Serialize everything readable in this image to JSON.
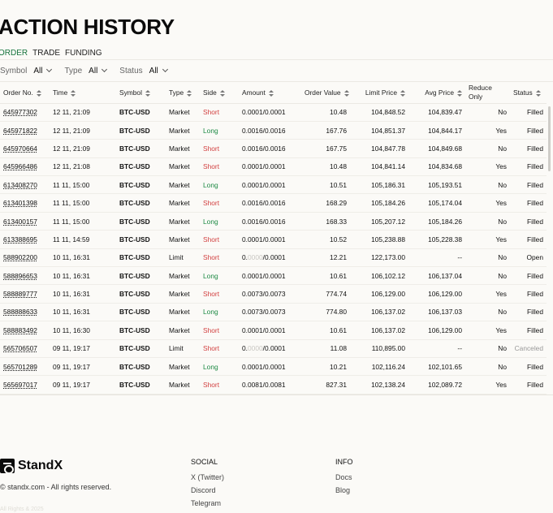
{
  "page": {
    "title": "ACTION HISTORY"
  },
  "tabs": [
    "ORDER",
    "TRADE",
    "FUNDING"
  ],
  "filters": [
    {
      "label": "Symbol",
      "value": "All"
    },
    {
      "label": "Type",
      "value": "All"
    },
    {
      "label": "Status",
      "value": "All"
    }
  ],
  "columns": [
    "Order No.",
    "Time",
    "Symbol",
    "Type",
    "Side",
    "Amount",
    "Order Value",
    "Limit Price",
    "Avg Price",
    "Reduce Only",
    "Status"
  ],
  "rows": [
    {
      "order_no": "645977302",
      "time": "12 11, 21:09",
      "symbol": "BTC-USD",
      "type": "Market",
      "side": "Short",
      "amount": "0.0001/0.0001",
      "order_value": "10.48",
      "limit_price": "104,848.52",
      "avg_price": "104,839.47",
      "reduce_only": "No",
      "status": "Filled"
    },
    {
      "order_no": "645971822",
      "time": "12 11, 21:09",
      "symbol": "BTC-USD",
      "type": "Market",
      "side": "Long",
      "amount": "0.0016/0.0016",
      "order_value": "167.76",
      "limit_price": "104,851.37",
      "avg_price": "104,844.17",
      "reduce_only": "Yes",
      "status": "Filled"
    },
    {
      "order_no": "645970664",
      "time": "12 11, 21:09",
      "symbol": "BTC-USD",
      "type": "Market",
      "side": "Short",
      "amount": "0.0016/0.0016",
      "order_value": "167.75",
      "limit_price": "104,847.78",
      "avg_price": "104,849.68",
      "reduce_only": "No",
      "status": "Filled"
    },
    {
      "order_no": "645966486",
      "time": "12 11, 21:08",
      "symbol": "BTC-USD",
      "type": "Market",
      "side": "Short",
      "amount": "0.0001/0.0001",
      "order_value": "10.48",
      "limit_price": "104,841.14",
      "avg_price": "104,834.68",
      "reduce_only": "Yes",
      "status": "Filled"
    },
    {
      "order_no": "613408270",
      "time": "11 11, 15:00",
      "symbol": "BTC-USD",
      "type": "Market",
      "side": "Long",
      "amount": "0.0001/0.0001",
      "order_value": "10.51",
      "limit_price": "105,186.31",
      "avg_price": "105,193.51",
      "reduce_only": "No",
      "status": "Filled"
    },
    {
      "order_no": "613401398",
      "time": "11 11, 15:00",
      "symbol": "BTC-USD",
      "type": "Market",
      "side": "Short",
      "amount": "0.0016/0.0016",
      "order_value": "168.29",
      "limit_price": "105,184.26",
      "avg_price": "105,174.04",
      "reduce_only": "Yes",
      "status": "Filled"
    },
    {
      "order_no": "613400157",
      "time": "11 11, 15:00",
      "symbol": "BTC-USD",
      "type": "Market",
      "side": "Long",
      "amount": "0.0016/0.0016",
      "order_value": "168.33",
      "limit_price": "105,207.12",
      "avg_price": "105,184.26",
      "reduce_only": "No",
      "status": "Filled"
    },
    {
      "order_no": "613388695",
      "time": "11 11, 14:59",
      "symbol": "BTC-USD",
      "type": "Market",
      "side": "Short",
      "amount": "0.0001/0.0001",
      "order_value": "10.52",
      "limit_price": "105,238.88",
      "avg_price": "105,228.38",
      "reduce_only": "Yes",
      "status": "Filled"
    },
    {
      "order_no": "588902200",
      "time": "10 11, 16:31",
      "symbol": "BTC-USD",
      "type": "Limit",
      "side": "Short",
      "amount_pre": "0.",
      "amount_faded": "0000",
      "amount_post": "/0.0001",
      "order_value": "12.21",
      "limit_price": "122,173.00",
      "avg_price": "--",
      "reduce_only": "No",
      "status": "Open"
    },
    {
      "order_no": "588896653",
      "time": "10 11, 16:31",
      "symbol": "BTC-USD",
      "type": "Market",
      "side": "Long",
      "amount": "0.0001/0.0001",
      "order_value": "10.61",
      "limit_price": "106,102.12",
      "avg_price": "106,137.04",
      "reduce_only": "No",
      "status": "Filled"
    },
    {
      "order_no": "588889777",
      "time": "10 11, 16:31",
      "symbol": "BTC-USD",
      "type": "Market",
      "side": "Short",
      "amount": "0.0073/0.0073",
      "order_value": "774.74",
      "limit_price": "106,129.00",
      "avg_price": "106,129.00",
      "reduce_only": "Yes",
      "status": "Filled"
    },
    {
      "order_no": "588888633",
      "time": "10 11, 16:31",
      "symbol": "BTC-USD",
      "type": "Market",
      "side": "Long",
      "amount": "0.0073/0.0073",
      "order_value": "774.80",
      "limit_price": "106,137.02",
      "avg_price": "106,137.03",
      "reduce_only": "No",
      "status": "Filled"
    },
    {
      "order_no": "588883492",
      "time": "10 11, 16:30",
      "symbol": "BTC-USD",
      "type": "Market",
      "side": "Short",
      "amount": "0.0001/0.0001",
      "order_value": "10.61",
      "limit_price": "106,137.02",
      "avg_price": "106,129.00",
      "reduce_only": "Yes",
      "status": "Filled"
    },
    {
      "order_no": "565706507",
      "time": "09 11, 19:17",
      "symbol": "BTC-USD",
      "type": "Limit",
      "side": "Short",
      "amount_pre": "0.",
      "amount_faded": "0000",
      "amount_post": "/0.0001",
      "order_value": "11.08",
      "limit_price": "110,895.00",
      "avg_price": "--",
      "reduce_only": "No",
      "status": "Canceled"
    },
    {
      "order_no": "565701289",
      "time": "09 11, 19:17",
      "symbol": "BTC-USD",
      "type": "Market",
      "side": "Long",
      "amount": "0.0001/0.0001",
      "order_value": "10.21",
      "limit_price": "102,116.24",
      "avg_price": "102,101.65",
      "reduce_only": "No",
      "status": "Filled"
    },
    {
      "order_no": "565697017",
      "time": "09 11, 19:17",
      "symbol": "BTC-USD",
      "type": "Market",
      "side": "Short",
      "amount": "0.0081/0.0081",
      "order_value": "827.31",
      "limit_price": "102,138.24",
      "avg_price": "102,089.72",
      "reduce_only": "Yes",
      "status": "Filled"
    }
  ],
  "colors": {
    "accent": "#16743d",
    "short": "#d24040",
    "long": "#1e8a45",
    "canceled": "#999999"
  },
  "footer": {
    "brand": "StandX",
    "copyright": "© standx.com - All rights reserved.",
    "faint_text": "All Rights & 2025",
    "social": {
      "heading": "SOCIAL",
      "links": [
        "X (Twitter)",
        "Discord",
        "Telegram"
      ]
    },
    "info": {
      "heading": "INFO",
      "links": [
        "Docs",
        "Blog"
      ]
    }
  }
}
